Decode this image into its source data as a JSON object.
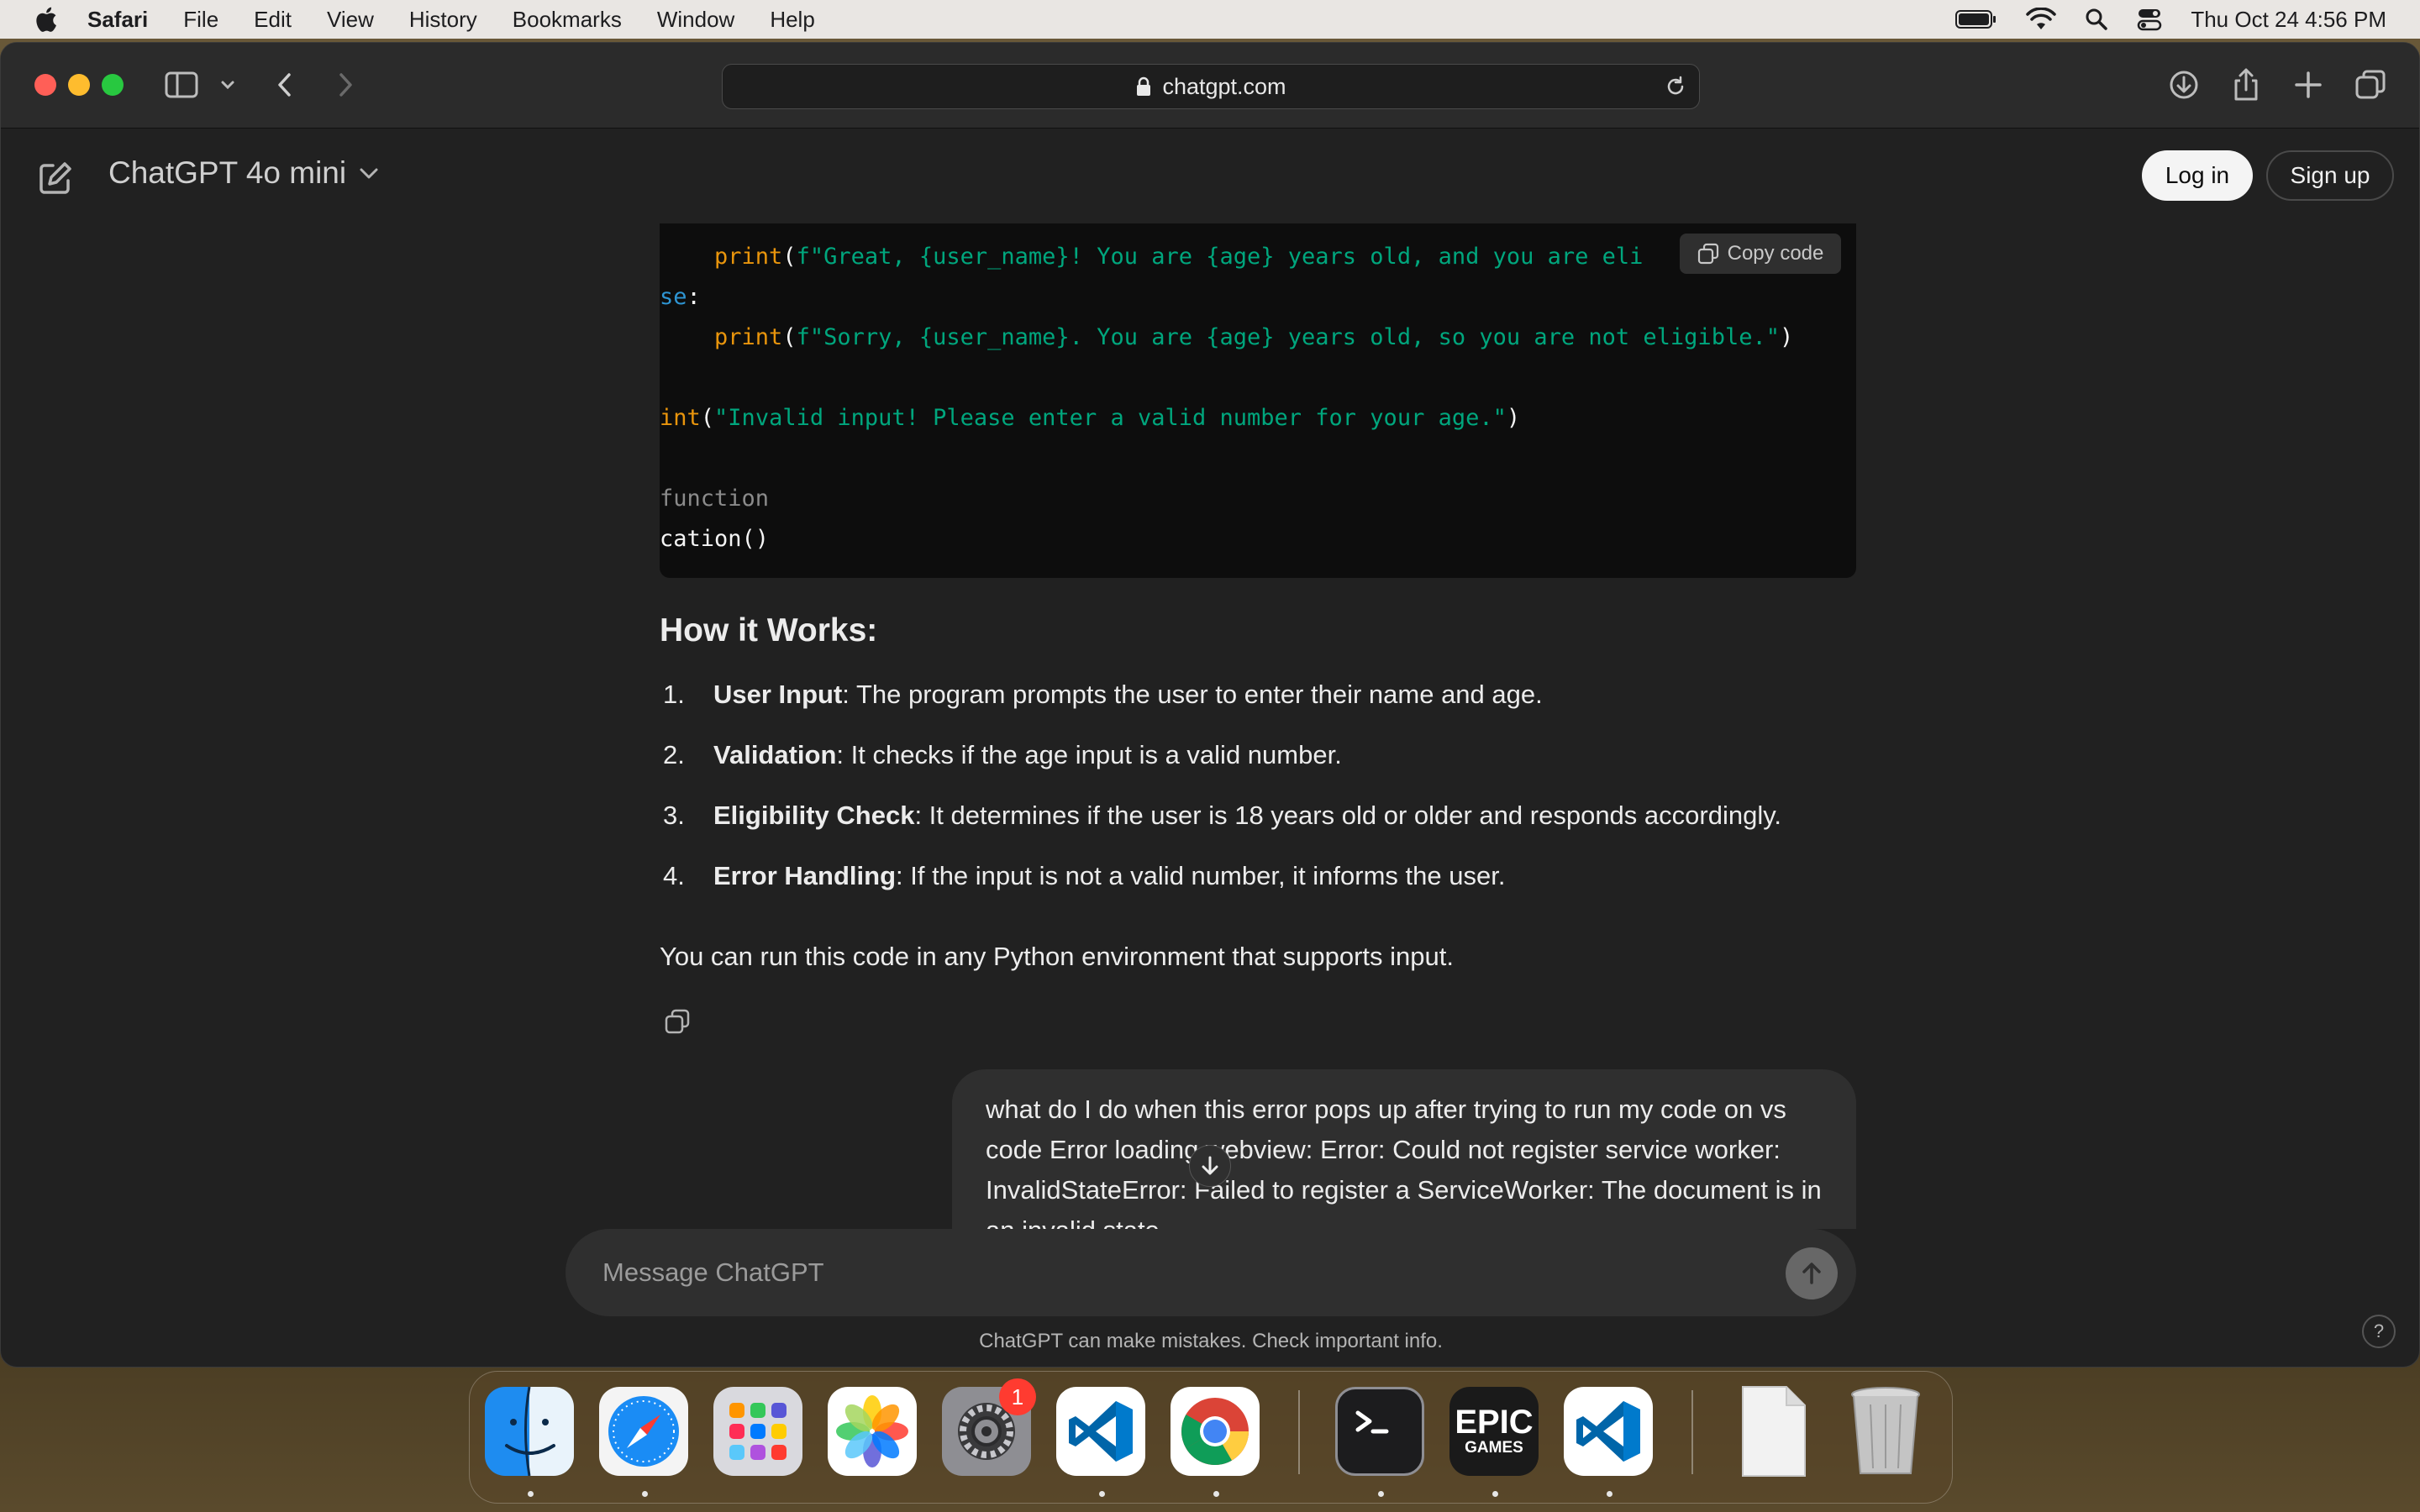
{
  "menubar": {
    "app_name": "Safari",
    "items": [
      "File",
      "Edit",
      "View",
      "History",
      "Bookmarks",
      "Window",
      "Help"
    ],
    "clock": "Thu Oct 24  4:56 PM"
  },
  "browser": {
    "url": "chatgpt.com"
  },
  "chat": {
    "model_name": "ChatGPT 4o mini",
    "login_label": "Log in",
    "signup_label": "Sign up",
    "copy_code_label": "Copy code",
    "code_lines": [
      [
        "    print",
        "(",
        "f\"Great, {user_name}! You are {age} years old, and you are eli"
      ],
      [
        "se",
        ":"
      ],
      [
        "    print",
        "(",
        "f\"Sorry, {user_name}. You are {age} years old, so you are not eligible.\"",
        ")"
      ],
      [
        "int",
        "(",
        "\"Invalid input! Please enter a valid number for your age.\"",
        ")"
      ],
      [
        "function"
      ],
      [
        "cation()"
      ]
    ],
    "how_heading": "How it Works:",
    "steps": [
      {
        "num": "1.",
        "title": "User Input",
        "text": ": The program prompts the user to enter their name and age."
      },
      {
        "num": "2.",
        "title": "Validation",
        "text": ": It checks if the age input is a valid number."
      },
      {
        "num": "3.",
        "title": "Eligibility Check",
        "text": ": It determines if the user is 18 years old or older and responds accordingly."
      },
      {
        "num": "4.",
        "title": "Error Handling",
        "text": ": If the input is not a valid number, it informs the user."
      }
    ],
    "closing_text": "You can run this code in any Python environment that supports input.",
    "user_message": "what do I do when this error pops up after trying to run my code on vs code Error loading webview: Error: Could not register service worker: InvalidStateError: Failed to register a ServiceWorker: The document is in an invalid state.",
    "composer_placeholder": "Message ChatGPT",
    "disclaimer": "ChatGPT can make mistakes. Check important info.",
    "help_label": "?"
  },
  "dock": {
    "system_preferences_badge": "1",
    "epic_label_1": "EPIC",
    "epic_label_2": "GAMES"
  },
  "colors": {
    "code_function": "#e9950c",
    "code_string": "#00a67d",
    "code_keyword": "#2e95d3",
    "code_comment": "#8b8b8b",
    "chat_background": "#212121"
  }
}
